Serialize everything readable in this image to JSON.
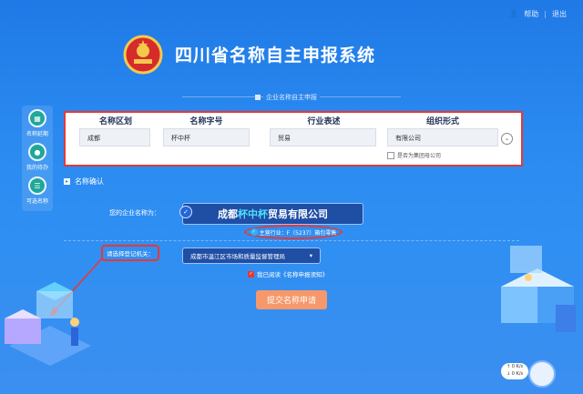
{
  "header": {
    "title": "四川省名称自主申报系统",
    "help_label": "帮助",
    "logout_label": "退出",
    "section_title": "企业名称自主申报"
  },
  "sidebar": {
    "items": [
      {
        "label": "名称延期",
        "icon": "calendar-icon"
      },
      {
        "label": "我的待办",
        "icon": "todo-icon"
      },
      {
        "label": "可选名称",
        "icon": "list-icon"
      }
    ]
  },
  "form": {
    "columns": [
      {
        "label": "名称区划",
        "value": "成都"
      },
      {
        "label": "名称字号",
        "value": "杯中杯"
      },
      {
        "label": "行业表述",
        "value": "贸易"
      },
      {
        "label": "组织形式",
        "value": "有限公司"
      }
    ],
    "group_parent_label": "是否为集团母公司"
  },
  "confirm": {
    "section_label": "名称确认",
    "your_name_label": "您的企业名称为：",
    "name_parts": [
      "成都",
      "杯中杯",
      "贸易有限公司"
    ],
    "industry_label": "主营行业：F（5237）箱包零售",
    "registry_label": "请选择登记机关：",
    "registry_value": "成都市温江区市场和质量监督管理局",
    "agree_label": "我已阅读《名称申报须知》",
    "submit_label": "提交名称申请"
  },
  "colors": {
    "background": "#2a8af0",
    "annotation_red": "#e53935",
    "submit": "#f6986a",
    "highlight": "#4ee1ff"
  }
}
